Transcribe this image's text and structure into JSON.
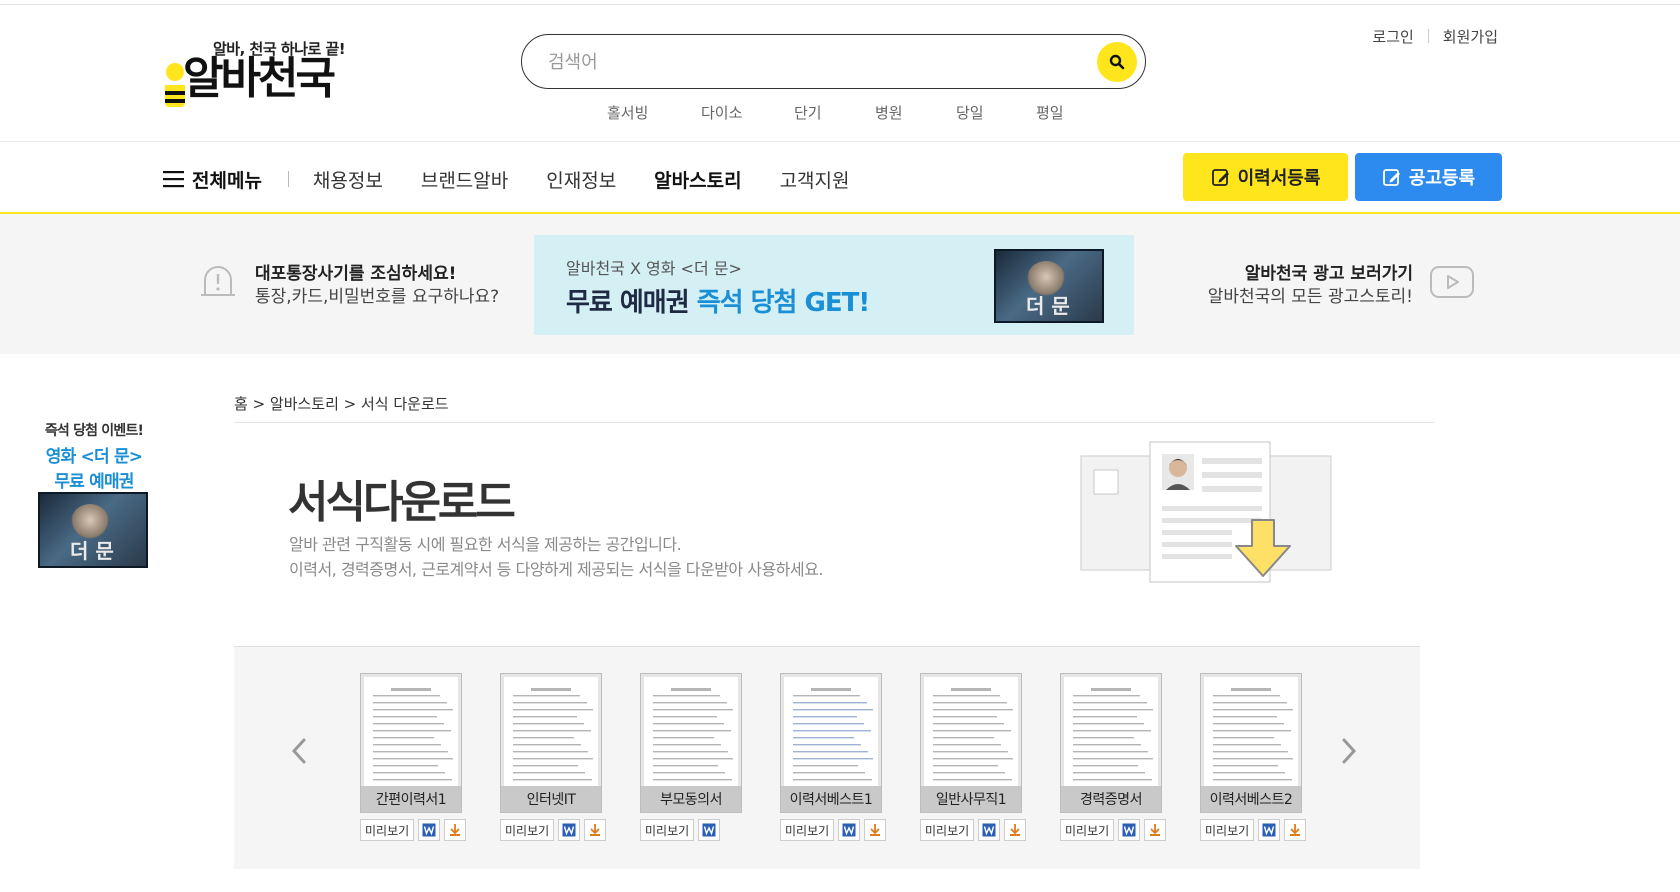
{
  "header": {
    "slogan": "알바, 천국 하나로 끝!",
    "logo_text": "알바천국",
    "search": {
      "placeholder": "검색어",
      "value": ""
    },
    "keywords": [
      "홀서빙",
      "다이소",
      "단기",
      "병원",
      "당일",
      "평일"
    ],
    "util_links": {
      "login": "로그인",
      "signup": "회원가입"
    }
  },
  "nav": {
    "all_menu": "전체메뉴",
    "items": [
      {
        "label": "채용정보",
        "active": false
      },
      {
        "label": "브랜드알바",
        "active": false
      },
      {
        "label": "인재정보",
        "active": false
      },
      {
        "label": "알바스토리",
        "active": true
      },
      {
        "label": "고객지원",
        "active": false
      }
    ],
    "resume_button": "이력서등록",
    "post_button": "공고등록"
  },
  "notice": {
    "warning_title": "대포통장사기를 조심하세요!",
    "warning_sub": "통장,카드,비밀번호를 요구하나요?",
    "banner_top": "알바천국 X 영화 <더 문>",
    "banner_main_a": "무료 예매권",
    "banner_main_b": "즉석 당첨 GET!",
    "banner_image_text": "더 문",
    "ad_title": "알바천국 광고 보러가기",
    "ad_sub": "알바천국의 모든 광고스토리!"
  },
  "side_ad": {
    "line1": "즉석 당첨 이벤트!",
    "line2": "영화 <더 문>",
    "line3": "무료 예매권",
    "image_text": "더 문"
  },
  "breadcrumb": "홈 > 알바스토리 > 서식 다운로드",
  "page": {
    "title": "서식다운로드",
    "desc1": "알바 관련 구직활동 시에 필요한 서식을 제공하는 공간입니다.",
    "desc2": "이력서, 경력증명서, 근로계약서 등 다양하게 제공되는 서식을 다운받아 사용하세요."
  },
  "documents": [
    {
      "label": "간편이력서1",
      "preview": "미리보기",
      "has_word": true,
      "has_hwp": true
    },
    {
      "label": "인터넷IT",
      "preview": "미리보기",
      "has_word": true,
      "has_hwp": true
    },
    {
      "label": "부모동의서",
      "preview": "미리보기",
      "has_word": true,
      "has_hwp": false
    },
    {
      "label": "이력서베스트1",
      "preview": "미리보기",
      "has_word": true,
      "has_hwp": true
    },
    {
      "label": "일반사무직1",
      "preview": "미리보기",
      "has_word": true,
      "has_hwp": true
    },
    {
      "label": "경력증명서",
      "preview": "미리보기",
      "has_word": true,
      "has_hwp": true
    },
    {
      "label": "이력서베스트2",
      "preview": "미리보기",
      "has_word": true,
      "has_hwp": true
    }
  ],
  "colors": {
    "brand_yellow": "#ffe51c",
    "post_blue": "#2d8bf0",
    "banner_bg": "#d4f0f5",
    "highlight_blue": "#1a8fd6"
  }
}
